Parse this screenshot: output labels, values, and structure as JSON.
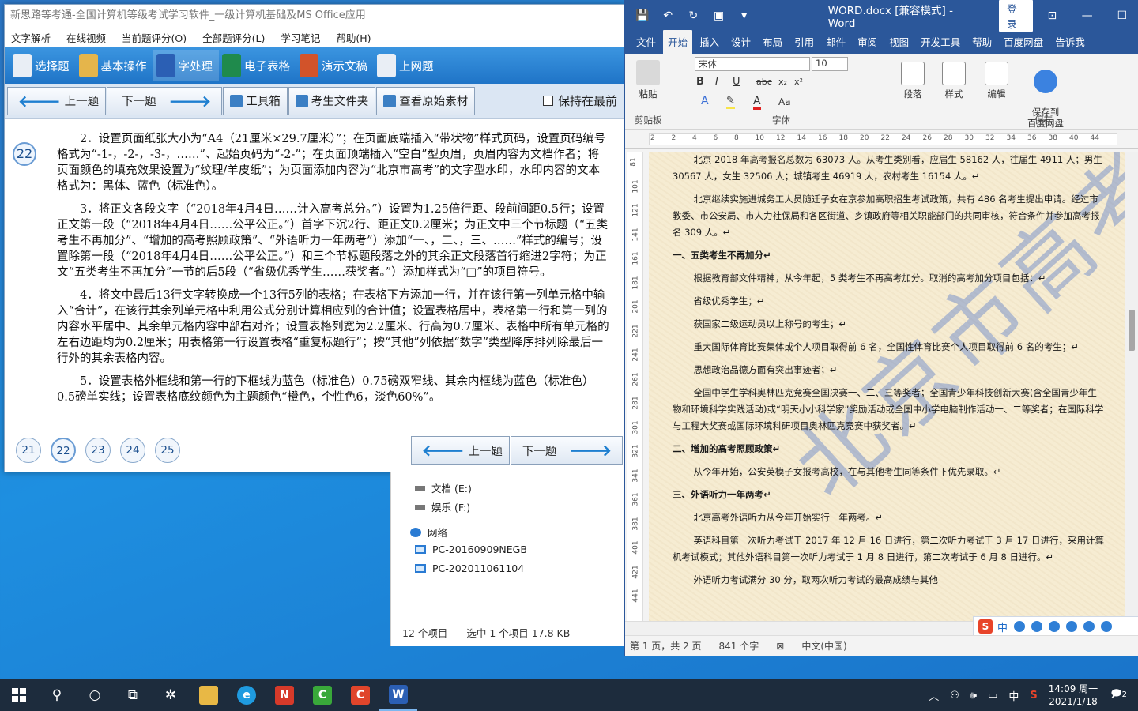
{
  "exam": {
    "title": "新思路等考通-全国计算机等级考试学习软件_一级计算机基础及MS Office应用",
    "menu": [
      "文字解析",
      "在线视频",
      "当前题评分(O)",
      "全部题评分(L)",
      "学习笔记",
      "帮助(H)"
    ],
    "modules": [
      "选择题",
      "基本操作",
      "字处理",
      "电子表格",
      "演示文稿",
      "上网题"
    ],
    "toolbar": {
      "prev": "上一题",
      "next": "下一题",
      "toolbox": "工具箱",
      "student_folder": "考生文件夹",
      "source_material": "查看原始素材",
      "keep_front": "保持在最前"
    },
    "current_question": "22",
    "paragraphs": [
      "2．设置页面纸张大小为“A4（21厘米×29.7厘米）”；在页面底端插入“带状物”样式页码，设置页码编号格式为“-1-，-2-，-3-，……”、起始页码为“-2-”；在页面顶端插入“空白”型页眉，页眉内容为文档作者；将页面颜色的填充效果设置为“纹理/羊皮纸”；为页面添加内容为“北京市高考”的文字型水印，水印内容的文本格式为：黑体、蓝色（标准色）。",
      "3．将正文各段文字（“2018年4月4日……计入高考总分。”）设置为1.25倍行距、段前间距0.5行；设置正文第一段（“2018年4月4日……公平公正。”）首字下沉2行、距正文0.2厘米；为正文中三个节标题（“五类考生不再加分”、“增加的高考照顾政策”、“外语听力一年两考”）添加“一、，二、，三、……”样式的编号；设置除第一段（“2018年4月4日……公平公正。”）和三个节标题段落之外的其余正文段落首行缩进2字符；为正文“五类考生不再加分”一节的后5段（“省级优秀学生……获奖者。”）添加样式为“□”的项目符号。",
      "4．将文中最后13行文字转换成一个13行5列的表格；在表格下方添加一行，并在该行第一列单元格中输入“合计”，在该行其余列单元格中利用公式分别计算相应列的合计值；设置表格居中，表格第一行和第一列的内容水平居中、其余单元格内容中部右对齐；设置表格列宽为2.2厘米、行高为0.7厘米、表格中所有单元格的左右边距均为0.2厘米；用表格第一行设置表格“重复标题行”；按“其他”列依据“数字”类型降序排列除最后一行外的其余表格内容。",
      "5．设置表格外框线和第一行的下框线为蓝色（标准色）0.75磅双窄线、其余内框线为蓝色（标准色）0.5磅单实线；设置表格底纹颜色为主题颜色“橙色，个性色6，淡色60%”。"
    ],
    "pages": [
      "21",
      "22",
      "23",
      "24",
      "25"
    ]
  },
  "explorer": {
    "items": [
      "文档 (E:)",
      "娱乐 (F:)",
      "网络",
      "PC-20160909NEGB",
      "PC-202011061104"
    ],
    "status": [
      "12 个项目",
      "选中 1 个项目  17.8 KB"
    ]
  },
  "word": {
    "title": "WORD.docx [兼容模式] - Word",
    "login": "登录",
    "tabs": [
      "文件",
      "开始",
      "插入",
      "设计",
      "布局",
      "引用",
      "邮件",
      "审阅",
      "视图",
      "开发工具",
      "帮助",
      "百度网盘",
      "告诉我"
    ],
    "ribbon": {
      "paste": "粘贴",
      "clipboard": "剪贴板",
      "font_name": "宋体",
      "font_size": "10",
      "font_group": "字体",
      "paragraph": "段落",
      "styles": "样式",
      "editing": "编辑",
      "save_baidu": "保存到\n百度网盘",
      "save_group": "保存"
    },
    "ruler_ticks": [
      "2",
      "2",
      "4",
      "6",
      "8",
      "10",
      "12",
      "14",
      "16",
      "18",
      "20",
      "22",
      "24",
      "26",
      "28",
      "30",
      "32",
      "34",
      "36",
      "38",
      "40",
      "44"
    ],
    "vruler_ticks": [
      "81",
      "101",
      "121",
      "141",
      "161",
      "181",
      "201",
      "221",
      "241",
      "261",
      "281",
      "301",
      "321",
      "341",
      "361",
      "381",
      "401",
      "421",
      "441"
    ],
    "watermark": "北京市高考",
    "doc": [
      {
        "h": false,
        "t": "北京 2018 年高考报名总数为 63073 人。从考生类别看，应届生 58162 人，往届生 4911 人；男生 30567 人，女生 32506 人；城镇考生 46919 人，农村考生 16154 人。↵"
      },
      {
        "h": false,
        "t": "北京继续实施进城务工人员随迁子女在京参加高职招生考试政策，共有 486 名考生提出申请。经过市教委、市公安局、市人力社保局和各区街道、乡镇政府等相关职能部门的共同审核，符合条件并参加高考报名 309 人。↵"
      },
      {
        "h": true,
        "t": "一、五类考生不再加分↵"
      },
      {
        "h": false,
        "t": "根据教育部文件精神，从今年起，5 类考生不再高考加分。取消的高考加分项目包括：↵"
      },
      {
        "h": false,
        "t": "省级优秀学生；↵"
      },
      {
        "h": false,
        "t": "获国家二级运动员以上称号的考生；↵"
      },
      {
        "h": false,
        "t": "重大国际体育比赛集体或个人项目取得前 6 名，全国性体育比赛个人项目取得前 6 名的考生；↵"
      },
      {
        "h": false,
        "t": "思想政治品德方面有突出事迹者；↵"
      },
      {
        "h": false,
        "t": "全国中学生学科奥林匹克竞赛全国决赛一、二、三等奖者；全国青少年科技创新大赛(含全国青少年生物和环境科学实践活动)或“明天小小科学家”奖励活动或全国中小学电脑制作活动一、二等奖者；在国际科学与工程大奖赛或国际环境科研项目奥林匹克竞赛中获奖者。↵"
      },
      {
        "h": true,
        "t": "二、增加的高考照顾政策↵"
      },
      {
        "h": false,
        "t": "从今年开始，公安英模子女报考高校，在与其他考生同等条件下优先录取。↵"
      },
      {
        "h": true,
        "t": "三、外语听力一年两考↵"
      },
      {
        "h": false,
        "t": "北京高考外语听力从今年开始实行一年两考。↵"
      },
      {
        "h": false,
        "t": "英语科目第一次听力考试于 2017 年 12 月 16 日进行，第二次听力考试于 3 月 17 日进行，采用计算机考试模式；其他外语科目第一次听力考试于 1 月 8 日进行，第二次考试于 6 月 8 日进行。↵"
      },
      {
        "h": false,
        "t": "外语听力考试满分 30 分，取两次听力考试的最高成绩与其他"
      }
    ],
    "status": {
      "page": "第 1 页，共 2 页",
      "words": "841 个字",
      "lang": "中文(中国)"
    },
    "ime": "中"
  },
  "taskbar": {
    "tray_input": "中",
    "time": "14:09 周一",
    "date": "2021/1/18",
    "notify_count": "2"
  }
}
